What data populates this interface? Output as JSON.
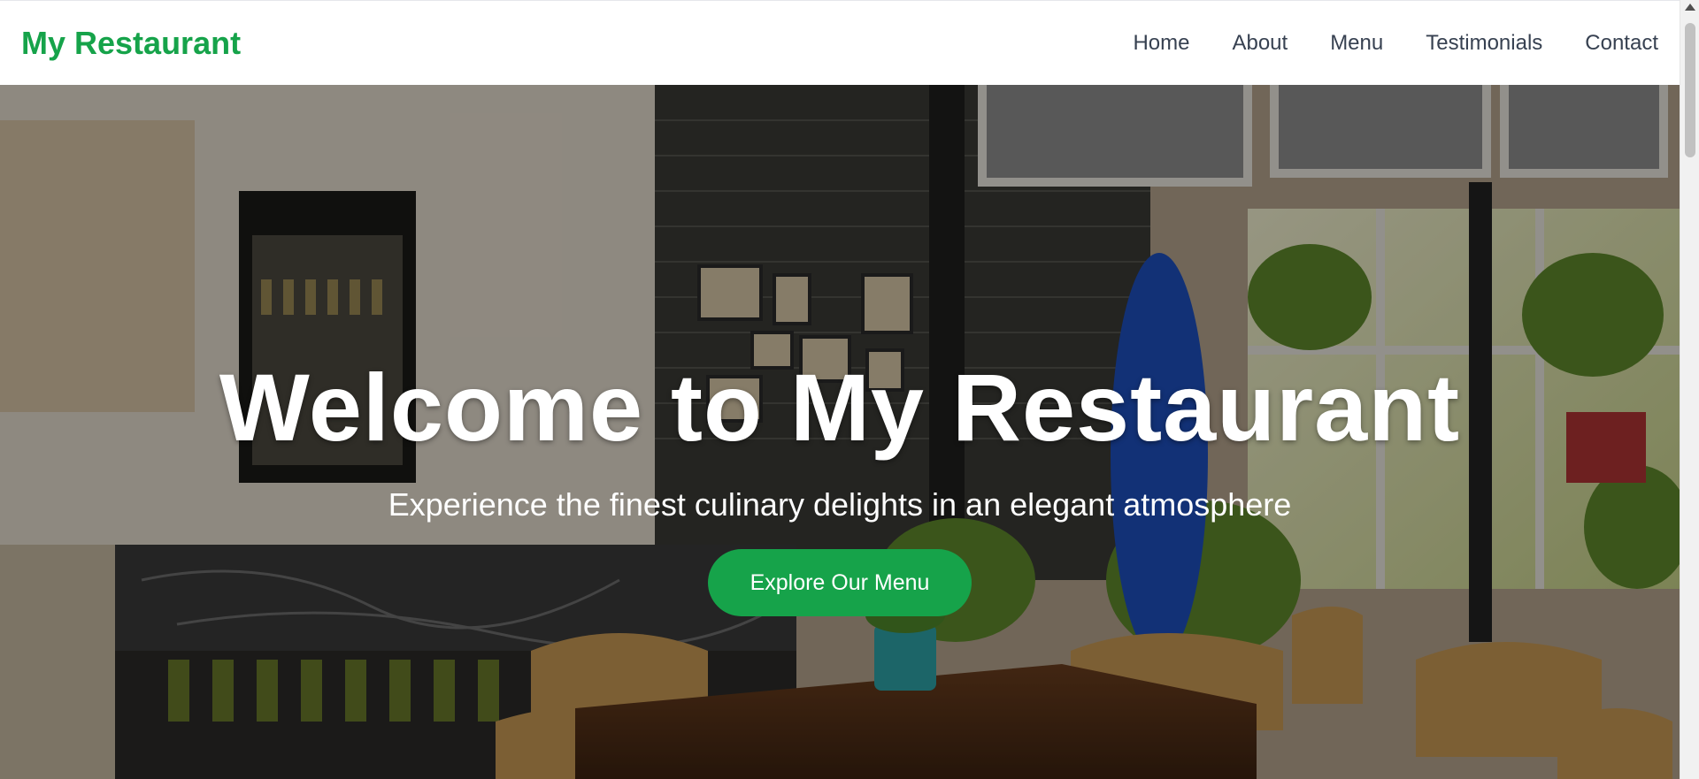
{
  "brand": {
    "name": "My Restaurant"
  },
  "nav": {
    "items": [
      {
        "label": "Home"
      },
      {
        "label": "About"
      },
      {
        "label": "Menu"
      },
      {
        "label": "Testimonials"
      },
      {
        "label": "Contact"
      }
    ]
  },
  "hero": {
    "title": "Welcome to My Restaurant",
    "subtitle": "Experience the finest culinary delights in an elegant atmosphere",
    "cta_label": "Explore Our Menu",
    "background_image": "restaurant-interior-photo"
  },
  "colors": {
    "brand": "#16a34a",
    "nav_text": "#374151",
    "hero_text": "#ffffff"
  },
  "icons": [
    "scroll-up-arrow-icon"
  ]
}
